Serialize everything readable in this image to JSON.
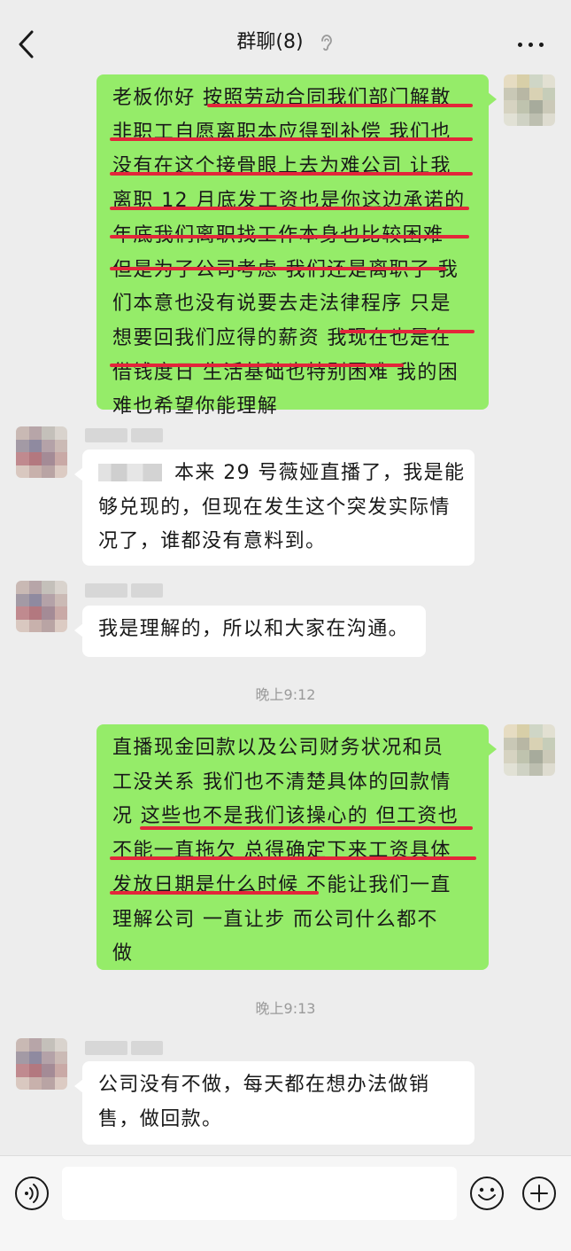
{
  "header": {
    "title": "群聊(8)",
    "back_icon": "chevron-left-icon",
    "mute_icon": "ear-icon",
    "more_icon": "more-dots-icon"
  },
  "messages": [
    {
      "sender": "me",
      "lines": [
        "老板你好 按照劳动合同我们部门解散",
        "非职工自愿离职本应得到补偿 我们也",
        "没有在这个接骨眼上去为难公司 让我",
        "离职 12 月底发工资也是你这边承诺的",
        "年底我们离职找工作本身也比较困难",
        "但是为了公司考虑 我们还是离职了 我",
        "们本意也没有说要去走法律程序 只是",
        "想要回我们应得的薪资  我现在也是在",
        "借钱度日 生活基础也特别困难 我的困",
        "难也希望你能理解"
      ]
    },
    {
      "sender": "other",
      "lines": [
        "本来 29 号薇娅直播了，我是能",
        "够兑现的，但现在发生这个突发实际情",
        "况了，谁都没有意料到。"
      ]
    },
    {
      "sender": "other",
      "lines": [
        "我是理解的，所以和大家在沟通。"
      ]
    },
    {
      "sender": "me",
      "lines": [
        "直播现金回款以及公司财务状况和员",
        "工没关系 我们也不清楚具体的回款情",
        "况 这些也不是我们该操心的 但工资也",
        "不能一直拖欠 总得确定下来工资具体",
        "发放日期是什么时候 不能让我们一直",
        "理解公司 一直让步 而公司什么都不",
        "做"
      ]
    },
    {
      "sender": "other",
      "lines": [
        "公司没有不做，每天都在想办法做销",
        "售，做回款。"
      ]
    }
  ],
  "timestamps": [
    "晚上9:12",
    "晚上9:13"
  ],
  "input_bar": {
    "voice_icon": "voice-icon",
    "emoji_icon": "emoji-icon",
    "plus_icon": "plus-circle-icon",
    "input_value": ""
  },
  "colors": {
    "background": "#ededed",
    "my_bubble": "#95ec69",
    "other_bubble": "#ffffff",
    "underline": "#e3263a",
    "timestamp": "#9a9a9a"
  }
}
